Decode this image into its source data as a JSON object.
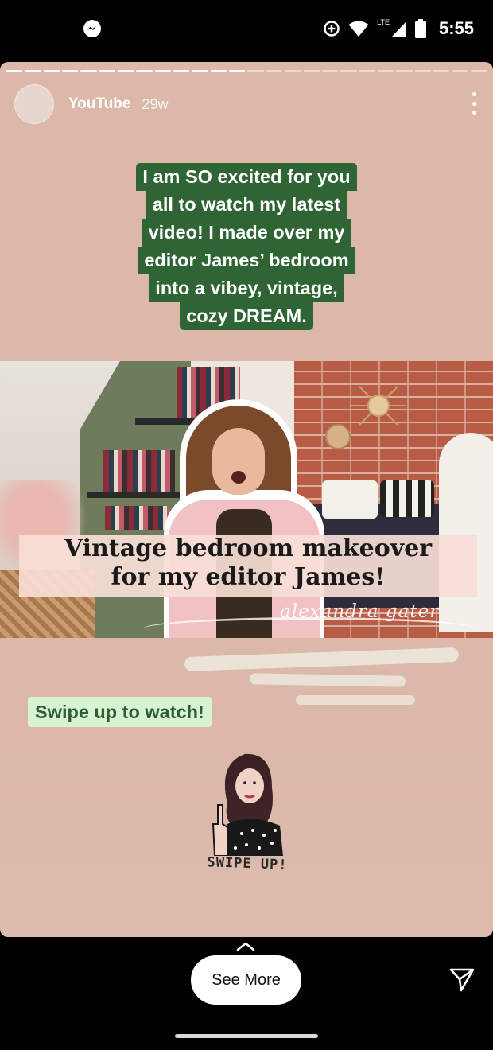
{
  "status_bar": {
    "time": "5:55",
    "network": "LTE",
    "icons": [
      "messenger-icon",
      "data-saver-icon",
      "wifi-icon",
      "signal-icon",
      "battery-icon"
    ]
  },
  "story": {
    "progress": {
      "segments": 26,
      "completed": 13
    },
    "account": {
      "name": "YouTube",
      "time_ago": "29w"
    },
    "caption": [
      "I am SO excited for you",
      "all to watch my latest",
      "video! I made over my",
      "editor James’ bedroom",
      "into a vibey, vintage,",
      "cozy DREAM."
    ],
    "video": {
      "title_lines": [
        "Vintage bedroom makeover",
        "for my editor James!"
      ],
      "signature": "alexandra gater"
    },
    "swipe_prompt": "Swipe up to watch!",
    "sticker_text": "SWIPE UP!"
  },
  "footer": {
    "see_more_label": "See More",
    "icons": [
      "chevron-up-icon",
      "send-icon"
    ]
  },
  "colors": {
    "story_background": "#dbb8a8",
    "caption_background": "#2f6434",
    "swipe_label_background": "#d8f3d4",
    "swipe_label_text": "#2c5e2e"
  }
}
